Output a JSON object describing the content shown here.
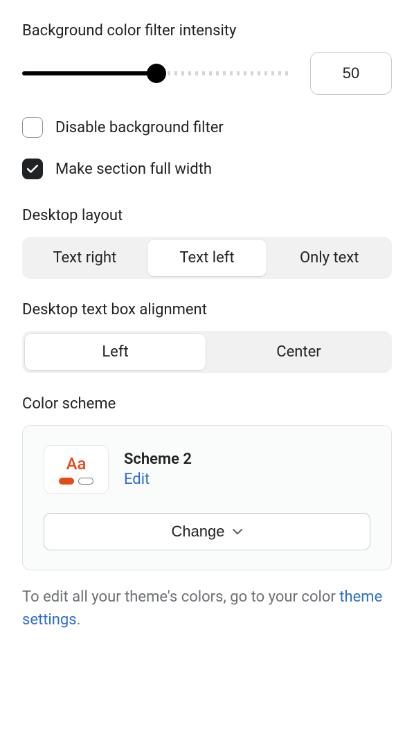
{
  "intensity": {
    "label": "Background color filter intensity",
    "value": "50",
    "percent": 50
  },
  "disable_filter": {
    "label": "Disable background filter",
    "checked": false
  },
  "full_width": {
    "label": "Make section full width",
    "checked": true
  },
  "desktop_layout": {
    "label": "Desktop layout",
    "options": [
      "Text right",
      "Text left",
      "Only text"
    ],
    "selected": 1
  },
  "desktop_align": {
    "label": "Desktop text box alignment",
    "options": [
      "Left",
      "Center"
    ],
    "selected": 0
  },
  "color_scheme": {
    "label": "Color scheme",
    "swatch_text": "Aa",
    "name": "Scheme 2",
    "edit_label": "Edit",
    "change_label": "Change"
  },
  "help": {
    "prefix": "To edit all your theme's colors, go to your color ",
    "link": "theme settings",
    "suffix": "."
  }
}
